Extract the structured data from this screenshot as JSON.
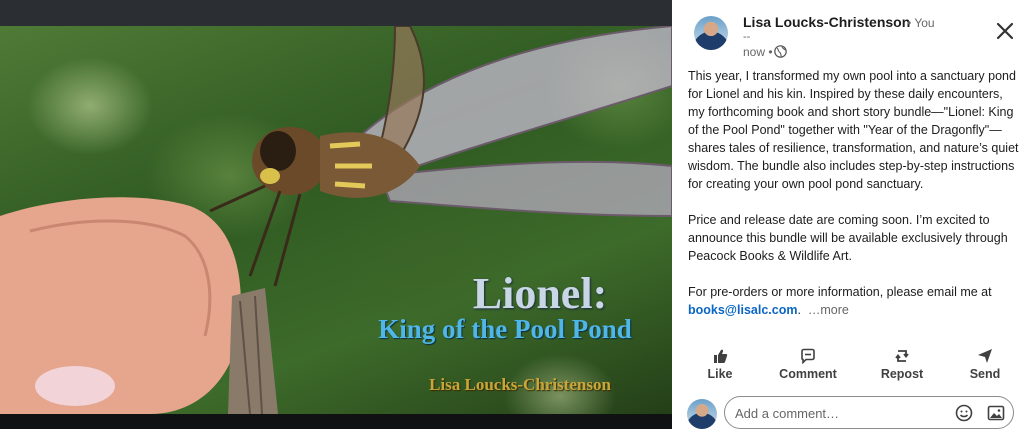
{
  "image_title": {
    "main": "Lionel:",
    "subtitle": "King of the Pool Pond",
    "author": "Lisa Loucks-Christenson"
  },
  "post": {
    "author_name": "Lisa Loucks-Christenson",
    "author_badge": "• You",
    "author_sub": "--",
    "time": "now •",
    "paragraphs": [
      "This year, I transformed my own pool into a sanctuary pond for Lionel and his kin. Inspired by these daily encounters, my forthcoming book and short story bundle—\"Lionel: King of the Pool Pond\" together with \"Year of the Dragonfly\"—shares tales of resilience, transformation, and nature’s quiet wisdom. The bundle also includes step-by-step instructions for creating your own pool pond sanctuary.",
      "Price and release date are coming soon. I’m excited to announce this bundle will be available exclusively through Peacock Books & Wildlife Art."
    ],
    "last_paragraph_prefix": "For pre-orders or more information, please email me at ",
    "email_link": "books@lisalc.com",
    "last_paragraph_suffix": ".",
    "more_label": "…more"
  },
  "actions": {
    "like": "Like",
    "comment": "Comment",
    "repost": "Repost",
    "send": "Send"
  },
  "comment_input": {
    "placeholder": "Add a comment…"
  },
  "icons": {
    "close": "close-icon",
    "globe": "globe-icon",
    "like": "thumbs-up-icon",
    "comment": "comment-bubble-icon",
    "repost": "repost-icon",
    "send": "send-icon",
    "emoji": "emoji-icon",
    "photo": "photo-icon"
  },
  "colors": {
    "link": "#0a66c2",
    "subtitle_blue": "#4fb6e8",
    "author_gold": "#c9a63a"
  }
}
